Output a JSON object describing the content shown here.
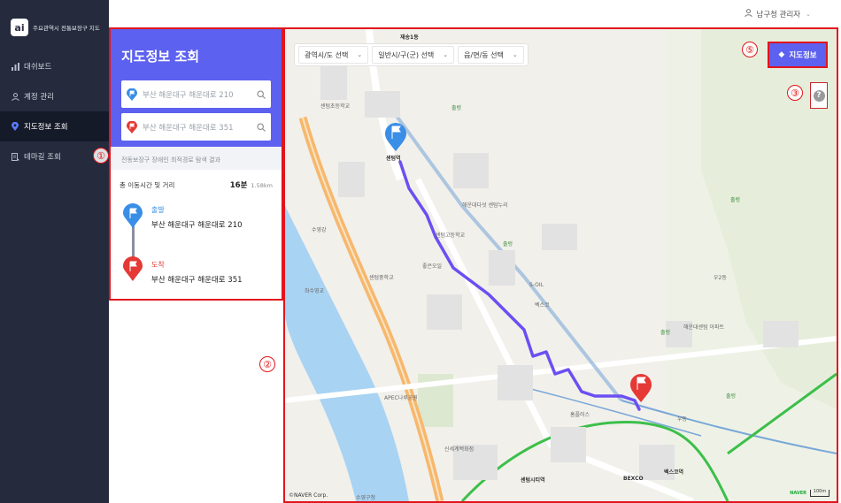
{
  "app": {
    "logo_text": "주요관역시 전통보장구 지도"
  },
  "sidebar": {
    "items": [
      {
        "label": "대쉬보드",
        "icon": "bar-chart-icon"
      },
      {
        "label": "계정 관리",
        "icon": "user-icon"
      },
      {
        "label": "지도정보 조회",
        "icon": "map-pin-icon",
        "active": true
      },
      {
        "label": "테마길 조회",
        "icon": "theme-road-icon"
      }
    ]
  },
  "header": {
    "user_label": "남구청 관리자"
  },
  "panel": {
    "title": "지도정보 조회",
    "origin_input": "부산 해운대구 해운대로 210",
    "destination_input": "부산 해운대구 해운대로 351",
    "result_title": "전동보장구 장애인 최적경로 탐색 결과",
    "total_label": "총 이동시간 및 거리",
    "total_time": "16분",
    "total_distance": "1.58km",
    "start_label": "출발",
    "start_address": "부산 해운대구 해운대로 210",
    "end_label": "도착",
    "end_address": "부산 해운대구 해운대로 351"
  },
  "map": {
    "select_city": "광역시/도 선택",
    "select_district": "일반시/구(군) 선택",
    "select_town": "읍/면/동 선택",
    "layer_button": "지도정보",
    "copyright": "©NAVER Corp.",
    "naver_logo": "NAVER",
    "scale": "100m",
    "labels": [
      "재송1동",
      "센텀초등학교",
      "센텀중학교",
      "센텀역",
      "센텀고등학교",
      "출렁",
      "해운대다섯 센텀누리",
      "출렁",
      "수영강",
      "좌수영교",
      "신세계백화점",
      "센텀시티역",
      "BEXCO",
      "벡스코역",
      "좋은오일",
      "S-OIL",
      "벡스코",
      "출렁",
      "우2동",
      "해운대센텀 아파트",
      "출렁",
      "홈플러스",
      "출렁",
      "APEC나루공원",
      "우동",
      "수영구청",
      "벡스코역",
      "센텀시티역"
    ],
    "route_color": "#6b4ff2"
  },
  "annotations": [
    "①",
    "②",
    "③",
    "⑤"
  ],
  "colors": {
    "sidebar_bg": "#252b3d",
    "accent": "#5c61ef",
    "annotation_red": "#e2141c",
    "start_blue": "#3a8ee6",
    "end_red": "#e53935"
  }
}
